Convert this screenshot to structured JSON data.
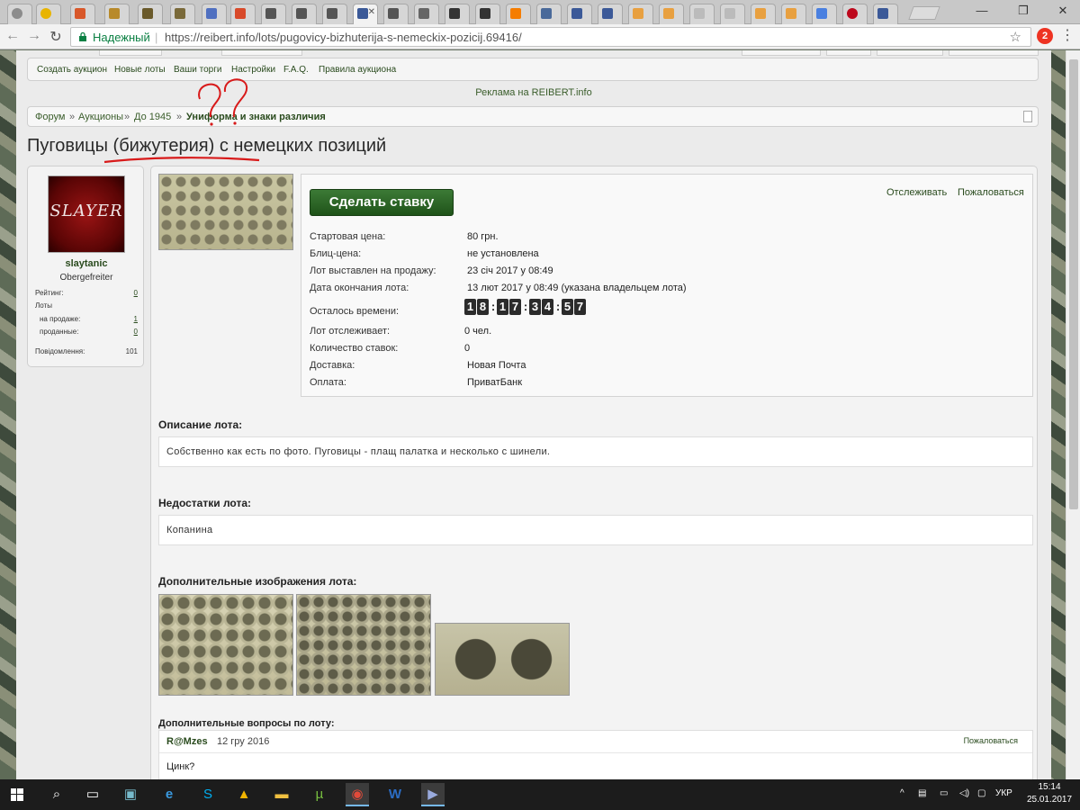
{
  "browser": {
    "secure_label": "Надежный",
    "url": "https://reibert.info/lots/pugovicy-bizhuterija-s-nemeckix-pozicij.69416/",
    "extension_badge": "2"
  },
  "subnav": {
    "items": [
      "Создать аукцион",
      "Новые лоты",
      "Ваши торги",
      "Настройки",
      "F.A.Q.",
      "Правила аукциона"
    ]
  },
  "ad_text": "Реклама на REIBERT.info",
  "breadcrumb": {
    "items": [
      "Форум",
      "Аукционы",
      "До 1945",
      "Униформа и знаки различия"
    ],
    "separator": "»"
  },
  "title": "Пуговицы (бижутерия) с немецких позиций",
  "annotation_marks": "??",
  "user": {
    "avatar_text": "SLAYER",
    "name": "slaytanic",
    "rank": "Obergefreiter",
    "stats": [
      {
        "label": "Рейтинг:",
        "value": "0"
      },
      {
        "label": "Лоты",
        "value": ""
      },
      {
        "label": "на продаже:",
        "value": "1"
      },
      {
        "label": "проданные:",
        "value": "0"
      },
      {
        "label": "Повідомлення:",
        "value": "101"
      }
    ]
  },
  "lot": {
    "bid_button": "Сделать ставку",
    "follow_link": "Отслеживать",
    "report_link": "Пожаловаться",
    "rows": [
      {
        "label": "Стартовая цена:",
        "value": "80 грн."
      },
      {
        "label": "Блиц-цена:",
        "value": "не установлена"
      },
      {
        "label": "Лот выставлен на продажу:",
        "value": "23 січ 2017 у 08:49"
      },
      {
        "label": "Дата окончания лота:",
        "value": "13 лют 2017 у 08:49 (указана владельцем лота)"
      },
      {
        "label": "Осталось времени:",
        "value": ""
      },
      {
        "label": "Лот отслеживает:",
        "value": "0 чел."
      },
      {
        "label": "Количество ставок:",
        "value": "0"
      },
      {
        "label": "Доставка:",
        "value": "Новая Почта"
      },
      {
        "label": "Оплата:",
        "value": "ПриватБанк"
      }
    ],
    "timer": [
      "18",
      "17",
      "34",
      "57"
    ]
  },
  "sections": {
    "description_title": "Описание лота:",
    "description": "Собственно как есть по фото. Пуговицы - плащ палатка и несколько с шинели.",
    "defects_title": "Недостатки лота:",
    "defects": "Копанина",
    "images_title": "Дополнительные изображения лота:",
    "questions_title": "Дополнительные вопросы по лоту:"
  },
  "question": {
    "author": "R@Mzes",
    "date": "12 гру 2016",
    "report": "Пожаловаться",
    "text": "Цинк?"
  },
  "taskbar": {
    "lang": "УКР",
    "time": "15:14",
    "date": "25.01.2017"
  },
  "colors": {
    "accent_green": "#2a4b1e",
    "bid_button": "#2f6a29",
    "annotation_red": "#d81a1a"
  }
}
